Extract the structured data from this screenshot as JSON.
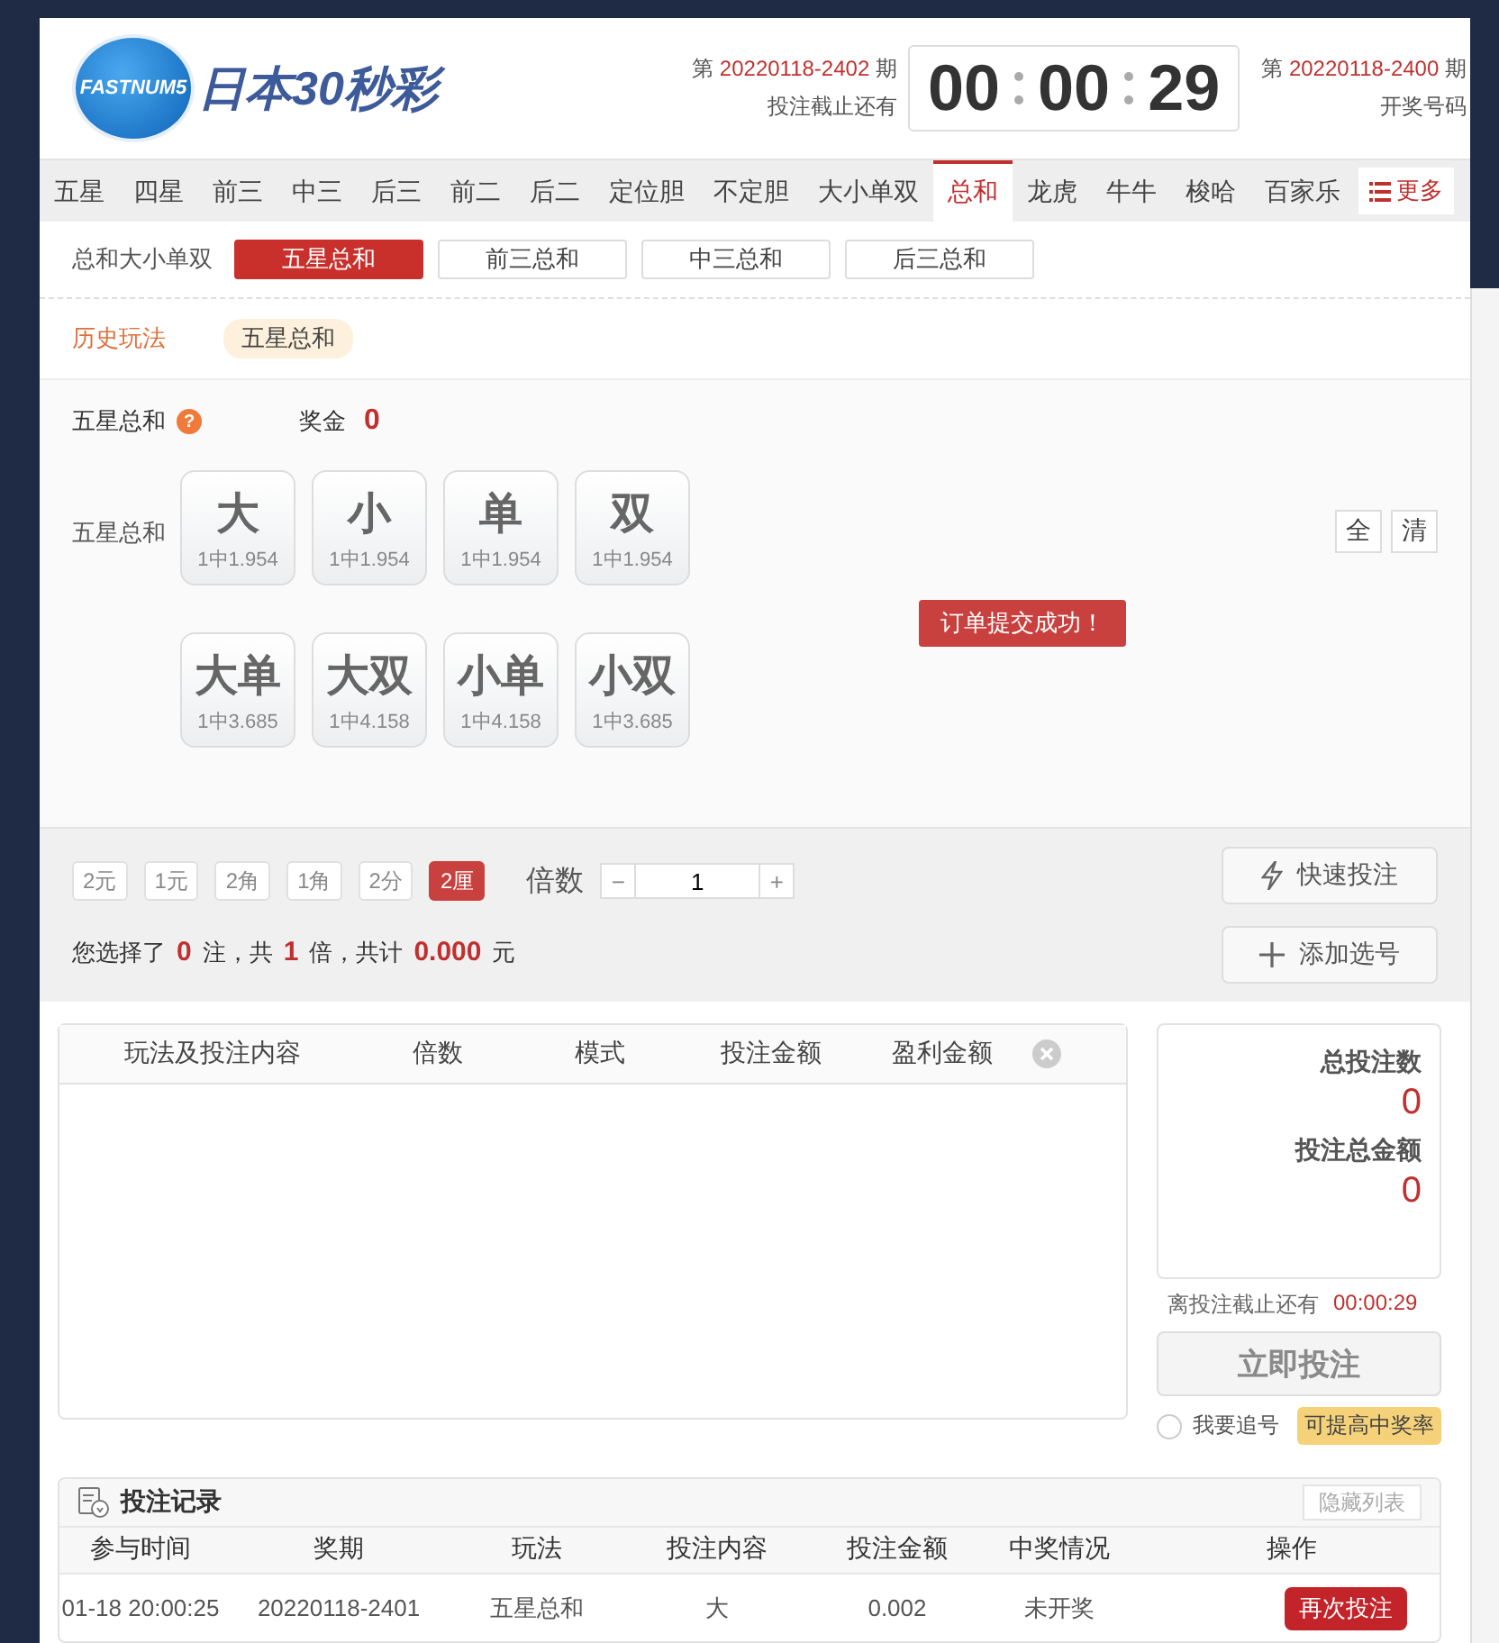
{
  "header": {
    "logo_badge": "FASTNUM5",
    "logo_title": "日本30秒彩",
    "current_issue": {
      "prefix": "第",
      "issue": "20220118-2402",
      "suffix": "期",
      "caption": "投注截止还有"
    },
    "countdown": [
      "00",
      "00",
      "29"
    ],
    "last_issue": {
      "prefix": "第",
      "issue": "20220118-2400",
      "suffix": "期",
      "caption": "开奖号码"
    }
  },
  "nav_tabs": [
    {
      "label": "五星",
      "selected": false
    },
    {
      "label": "四星",
      "selected": false
    },
    {
      "label": "前三",
      "selected": false
    },
    {
      "label": "中三",
      "selected": false
    },
    {
      "label": "后三",
      "selected": false
    },
    {
      "label": "前二",
      "selected": false
    },
    {
      "label": "后二",
      "selected": false
    },
    {
      "label": "定位胆",
      "selected": false
    },
    {
      "label": "不定胆",
      "selected": false
    },
    {
      "label": "大小单双",
      "selected": false
    },
    {
      "label": "总和",
      "selected": true
    },
    {
      "label": "龙虎",
      "selected": false
    },
    {
      "label": "牛牛",
      "selected": false
    },
    {
      "label": "梭哈",
      "selected": false
    },
    {
      "label": "百家乐",
      "selected": false
    }
  ],
  "more_button": "更多",
  "sub_group_label": "总和大小单双",
  "sub_tabs": [
    {
      "label": "五星总和",
      "selected": true
    },
    {
      "label": "前三总和",
      "selected": false
    },
    {
      "label": "中三总和",
      "selected": false
    },
    {
      "label": "后三总和",
      "selected": false
    }
  ],
  "history": {
    "label": "历史玩法",
    "items": [
      "五星总和"
    ]
  },
  "play": {
    "title": "五星总和",
    "help": "?",
    "prize_label": "奖金",
    "prize_value": "0",
    "row_label": "五星总和",
    "options": [
      [
        {
          "label": "大",
          "odds": "1中1.954",
          "selected": false
        },
        {
          "label": "小",
          "odds": "1中1.954",
          "selected": false
        },
        {
          "label": "单",
          "odds": "1中1.954",
          "selected": false
        },
        {
          "label": "双",
          "odds": "1中1.954",
          "selected": false
        }
      ],
      [
        {
          "label": "大单",
          "odds": "1中3.685",
          "selected": false
        },
        {
          "label": "大双",
          "odds": "1中4.158",
          "selected": false
        },
        {
          "label": "小单",
          "odds": "1中4.158",
          "selected": false
        },
        {
          "label": "小双",
          "odds": "1中3.685",
          "selected": false
        }
      ]
    ],
    "quick_buttons": [
      "全",
      "清"
    ],
    "toast": "订单提交成功！"
  },
  "bet_bar": {
    "units": [
      {
        "label": "2元",
        "selected": false
      },
      {
        "label": "1元",
        "selected": false
      },
      {
        "label": "2角",
        "selected": false
      },
      {
        "label": "1角",
        "selected": false
      },
      {
        "label": "2分",
        "selected": false
      },
      {
        "label": "2厘",
        "selected": true
      }
    ],
    "multiplier_label": "倍数",
    "minus": "−",
    "multiplier_value": "1",
    "plus": "+",
    "quick_bet": "快速投注",
    "add_selection": "添加选号",
    "summary": [
      {
        "kind": "text",
        "text": "您选择了"
      },
      {
        "kind": "num",
        "text": "0"
      },
      {
        "kind": "text",
        "text": "注，共"
      },
      {
        "kind": "num",
        "text": "1"
      },
      {
        "kind": "text",
        "text": "倍，共计"
      },
      {
        "kind": "num",
        "text": "0.000"
      },
      {
        "kind": "text",
        "text": "元"
      }
    ]
  },
  "cart": {
    "columns": [
      "玩法及投注内容",
      "倍数",
      "模式",
      "投注金额",
      "盈利金额"
    ]
  },
  "totals": {
    "count_label": "总投注数",
    "count_value": "0",
    "amount_label": "投注总金额",
    "amount_value": "0",
    "deadline_label": "离投注截止还有",
    "deadline_value": "00:00:29",
    "submit": "立即投注",
    "submit_disabled": true,
    "chase_label": "我要追号",
    "chase_checked": false,
    "chase_badge": "可提高中奖率"
  },
  "records": {
    "title": "投注记录",
    "hide_button": "隐藏列表",
    "columns": [
      "参与时间",
      "奖期",
      "玩法",
      "投注内容",
      "投注金额",
      "中奖情况",
      "操作"
    ],
    "rows": [
      {
        "cells": [
          "01-18 20:00:25",
          "20220118-2401",
          "五星总和",
          "大",
          "0.002",
          "未开奖"
        ],
        "action": "再次投注"
      }
    ]
  }
}
